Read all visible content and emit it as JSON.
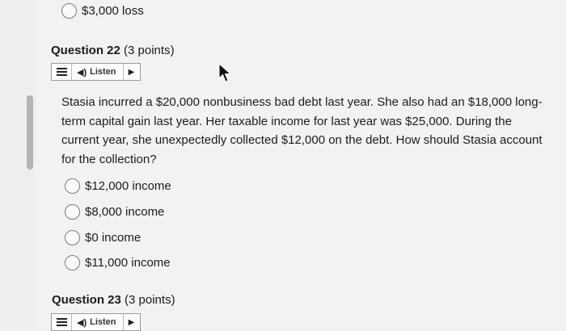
{
  "prev_option": {
    "label": "$3,000 loss"
  },
  "question22": {
    "title": "Question 22",
    "points": "(3 points)",
    "listen": {
      "label": "Listen"
    },
    "text": "Stasia incurred a $20,000 nonbusiness bad debt last year. She also had an $18,000 long-term capital gain last year. Her taxable income for last year was $25,000. During the current year, she unexpectedly collected $12,000 on the debt. How should Stasia account for the collection?",
    "options": [
      "$12,000 income",
      "$8,000 income",
      "$0 income",
      "$11,000 income"
    ]
  },
  "question23": {
    "title": "Question 23",
    "points": "(3 points)",
    "listen": {
      "label": "Listen"
    }
  }
}
